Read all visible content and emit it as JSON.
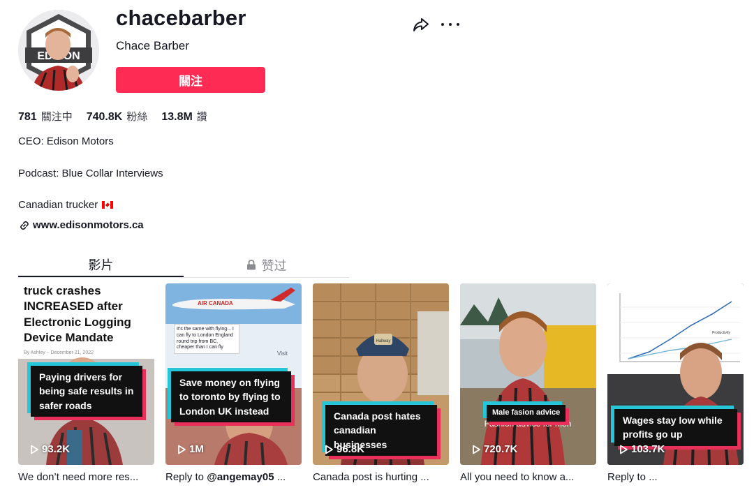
{
  "profile": {
    "username": "chacebarber",
    "nickname": "Chace Barber",
    "follow_label": "關注",
    "share_icon": "share-icon",
    "more_icon": "more-icon",
    "avatar_badge": "EDISON"
  },
  "stats": [
    {
      "value": "781",
      "label": "關注中"
    },
    {
      "value": "740.8K",
      "label": "粉絲"
    },
    {
      "value": "13.8M",
      "label": "讚"
    }
  ],
  "bio": {
    "line1": "CEO: Edison Motors",
    "line2": "Podcast: Blue Collar Interviews",
    "line3": "Canadian trucker",
    "flag_icon": "canada-flag-icon",
    "link": "www.edisonmotors.ca"
  },
  "tabs": {
    "videos": "影片",
    "liked": "赞过"
  },
  "videos": [
    {
      "headline": "truck crashes INCREASED after Electronic Logging Device Mandate",
      "byline": "By Ashley – December 21, 2022",
      "overlay": "Paying drivers for being safe results in safer roads",
      "views": "93.2K",
      "caption": "We don’t need more res..."
    },
    {
      "plane_text": "AIR CANADA",
      "tweet": "It's the same with flying... I can fly to London England round trip from BC, cheaper than I can fly",
      "overlay": "Save money on flying to toronto by flying to London UK instead",
      "views": "1M",
      "caption_prefix": "Reply to ",
      "caption_mention": "@angemay05",
      "caption_suffix": " ...",
      "visit": "Visit"
    },
    {
      "hat_text": "Hallway",
      "overlay": "Canada post hates canadian businesses",
      "views": "96.8K",
      "caption": "Canada post is hurting ..."
    },
    {
      "overlay": "Male fasion advice",
      "subtitle": "Fashion advice for men",
      "views": "720.7K",
      "caption": "All you need to know a..."
    },
    {
      "overlay": "Wages stay low while profits go up",
      "views": "103.7K",
      "caption": "Reply to ...",
      "chart_label": "Productivity"
    }
  ],
  "colors": {
    "brand_red": "#fe2c55",
    "text": "#161823",
    "muted": "#8a8b91",
    "tag_cyan": "#25c6d8",
    "tag_pink": "#e8305a"
  }
}
